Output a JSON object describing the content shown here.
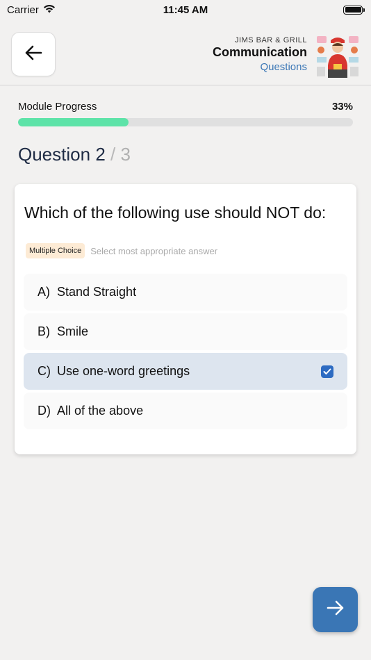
{
  "status_bar": {
    "carrier": "Carrier",
    "time": "11:45 AM"
  },
  "header": {
    "subtitle": "JIMS BAR & GRILL",
    "title": "Communication",
    "link": "Questions",
    "back_icon": "arrow-left-icon",
    "image": "chef-illustration"
  },
  "progress": {
    "label": "Module Progress",
    "percent_text": "33%",
    "value": 0.33
  },
  "question_counter": {
    "prefix": "Question",
    "current": "2",
    "separator": "/",
    "total": "3"
  },
  "question": {
    "text": "Which of the following use should NOT do:",
    "type_badge": "Multiple Choice",
    "hint": "Select most appropriate answer",
    "options": [
      {
        "letter": "A)",
        "label": "Stand Straight",
        "selected": false
      },
      {
        "letter": "B)",
        "label": "Smile",
        "selected": false
      },
      {
        "letter": "C)",
        "label": "Use one-word greetings",
        "selected": true
      },
      {
        "letter": "D)",
        "label": "All of the above",
        "selected": false
      }
    ]
  },
  "next_button": {
    "icon": "arrow-right-icon"
  },
  "colors": {
    "accent": "#3a76b5",
    "progress": "#5de3a8",
    "selected_bg": "#dde5ef",
    "checkbox": "#2d6bc2",
    "badge_bg": "#fdebd5"
  }
}
